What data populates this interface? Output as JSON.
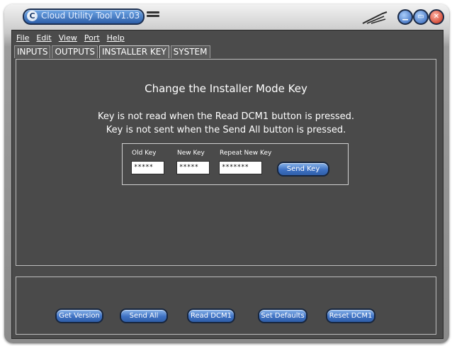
{
  "window": {
    "title": "Cloud Utility Tool V1.03",
    "logo_letter": "C"
  },
  "title_buttons": {
    "minimize": "▁",
    "maximize": "▭",
    "close": "✕"
  },
  "menu": [
    "File",
    "Edit",
    "View",
    "Port",
    "Help"
  ],
  "tabs": [
    {
      "label": "INPUTS",
      "active": false
    },
    {
      "label": "OUTPUTS",
      "active": false
    },
    {
      "label": "INSTALLER KEY",
      "active": true
    },
    {
      "label": "SYSTEM",
      "active": false
    }
  ],
  "installer": {
    "heading": "Change the Installer Mode Key",
    "line1": "Key is not read when the Read DCM1 button is pressed.",
    "line2": "Key is not sent when the Send All button is pressed.",
    "old_key_label": "Old Key",
    "old_key_value": "*****",
    "new_key_label": "New Key",
    "new_key_value": "*****",
    "repeat_key_label": "Repeat New Key",
    "repeat_key_value": "*******",
    "send_key_button": "Send Key"
  },
  "bottom_buttons": [
    "Get Version",
    "Send All",
    "Read DCM1",
    "Set Defaults",
    "Reset DCM1"
  ],
  "colors": {
    "panel": "#4a4a4a",
    "button_blue": "#3f72c4",
    "close_red": "#c42710"
  }
}
